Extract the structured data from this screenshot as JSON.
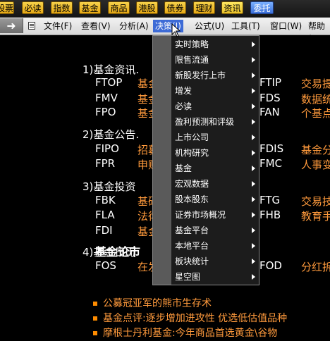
{
  "top_tabs": [
    {
      "label": "股票"
    },
    {
      "label": "必读"
    },
    {
      "label": "指数"
    },
    {
      "label": "基金"
    },
    {
      "label": "商品"
    },
    {
      "label": "港股"
    },
    {
      "label": "债券"
    },
    {
      "label": "理财"
    },
    {
      "label": "资讯"
    },
    {
      "label": "委托"
    }
  ],
  "menu": [
    {
      "label": "文件(F)"
    },
    {
      "label": "查看(V)"
    },
    {
      "label": "分析(A)"
    },
    {
      "label": "决策(J)"
    },
    {
      "label": "公式(U)"
    },
    {
      "label": "工具(T)"
    },
    {
      "label": "窗口(W)"
    },
    {
      "label": "帮助("
    }
  ],
  "sections": [
    {
      "title": "1)基金资讯.",
      "rows": [
        {
          "code": "FTOP",
          "desc": "基金",
          "code2": "FTIP",
          "desc2": "交易提"
        },
        {
          "code": "FMV",
          "desc": "基金",
          "code2": "FDS",
          "desc2": "数据统"
        },
        {
          "code": "FPO",
          "desc": "基金",
          "code2": "FAN",
          "desc2": "个基点"
        }
      ]
    },
    {
      "title": "2)基金公告.",
      "rows": [
        {
          "code": "FIPO",
          "desc": "招募",
          "code2": "FDIS",
          "desc2": "基金分"
        },
        {
          "code": "FPR",
          "desc": "申购",
          "code2": "FMC",
          "desc2": "人事变"
        }
      ]
    },
    {
      "title": "3)基金投资",
      "rows": [
        {
          "code": "FBK",
          "desc": "基础",
          "code2": "FTG",
          "desc2": "交易技"
        },
        {
          "code": "FLA",
          "desc": "法律",
          "code2": "FHB",
          "desc2": "教育手"
        },
        {
          "code": "FDI",
          "desc": "基金",
          "code2": "",
          "desc2": ""
        }
      ]
    },
    {
      "title": "4)基金日历",
      "rows": [
        {
          "code": "FOS",
          "desc": "在发",
          "code2": "FOD",
          "desc2": "分红拆"
        }
      ]
    }
  ],
  "news": {
    "title": "基金论市",
    "items": [
      "公募冠亚军的熊市生存术",
      "基金点评:逐步增加进攻性 优选低估值品种",
      "摩根士丹利基金:今年商品首选黄金\\谷物"
    ]
  },
  "dropdown": [
    {
      "label": "实时策略"
    },
    {
      "label": "限售流通"
    },
    {
      "label": "新股发行上市"
    },
    {
      "label": "增发"
    },
    {
      "label": "必读"
    },
    {
      "label": "盈利预测和评级"
    },
    {
      "label": "上市公司"
    },
    {
      "label": "机构研究"
    },
    {
      "label": "基金"
    },
    {
      "label": "宏观数据"
    },
    {
      "label": "股本股东"
    },
    {
      "label": "证券市场概况"
    },
    {
      "label": "基金平台"
    },
    {
      "label": "本地平台"
    },
    {
      "label": "板块统计"
    },
    {
      "label": "星空图"
    }
  ],
  "colors": {
    "accent": "#ff9a3c",
    "menu_highlight": "#3d6bd6",
    "tab": "#f0c230"
  }
}
